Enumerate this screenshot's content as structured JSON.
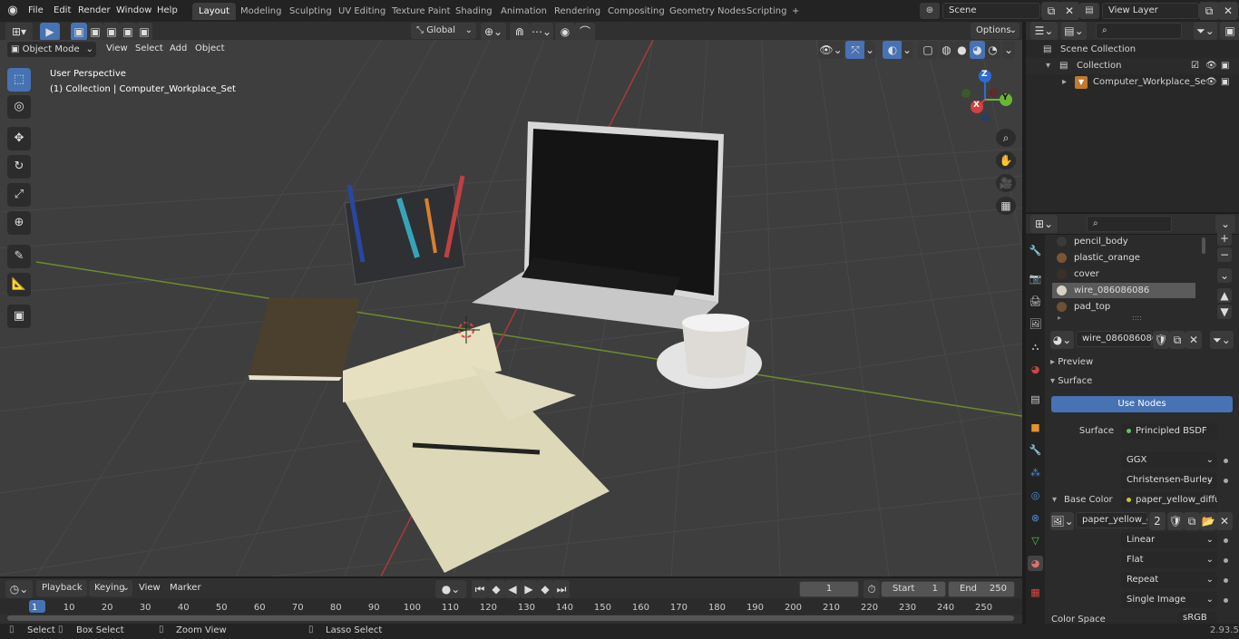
{
  "topbar": {
    "menus": [
      "File",
      "Edit",
      "Render",
      "Window",
      "Help"
    ],
    "workspaces": [
      "Layout",
      "Modeling",
      "Sculpting",
      "UV Editing",
      "Texture Paint",
      "Shading",
      "Animation",
      "Rendering",
      "Compositing",
      "Geometry Nodes",
      "Scripting"
    ],
    "add_tab": "+",
    "scene": "Scene",
    "view_layer": "View Layer"
  },
  "viewport": {
    "transform_orientation": "Global",
    "options": "Options",
    "mode": "Object Mode",
    "menus": [
      "View",
      "Select",
      "Add",
      "Object"
    ],
    "perspective": "User Perspective",
    "collection_info": "(1) Collection | Computer_Workplace_Set",
    "gizmo": {
      "x": "X",
      "y": "Y",
      "z": "Z"
    }
  },
  "outliner": {
    "search": "",
    "items": [
      "Scene Collection",
      "Collection",
      "Computer_Workplace_Se"
    ]
  },
  "properties": {
    "search": "",
    "slots": [
      "pencil_body",
      "plastic_orange",
      "cover",
      "wire_086086086",
      "pad_top"
    ],
    "slot_colors": [
      "#3a3a3a",
      "#7a5536",
      "#3a3028",
      "#d8d2c4",
      "#6e5036"
    ],
    "material_name": "wire_086086086",
    "sections": {
      "preview": "Preview",
      "surface": "Surface"
    },
    "use_nodes": "Use Nodes",
    "surface_label": "Surface",
    "surface_value": "Principled BSDF",
    "distribution": "GGX",
    "subsurface": "Christensen-Burley",
    "base_color_label": "Base Color",
    "base_color_value": "paper_yellow_diffus...",
    "image_name": "paper_yellow_di...",
    "image_users": "2",
    "interpolation": "Linear",
    "projection": "Flat",
    "extension": "Repeat",
    "source": "Single Image",
    "color_space_label": "Color Space",
    "color_space": "sRGB"
  },
  "timeline": {
    "menus": [
      "Playback",
      "Keying",
      "View",
      "Marker"
    ],
    "current_frame": "1",
    "start_label": "Start",
    "start": "1",
    "end_label": "End",
    "end": "250",
    "ticks": [
      "1",
      "10",
      "20",
      "30",
      "40",
      "50",
      "60",
      "70",
      "80",
      "90",
      "100",
      "110",
      "120",
      "130",
      "140",
      "150",
      "160",
      "170",
      "180",
      "190",
      "200",
      "210",
      "220",
      "230",
      "240",
      "250"
    ]
  },
  "status": {
    "select": "Select",
    "box_select": "Box Select",
    "zoom_view": "Zoom View",
    "lasso_select": "Lasso Select",
    "version": "2.93.5"
  }
}
